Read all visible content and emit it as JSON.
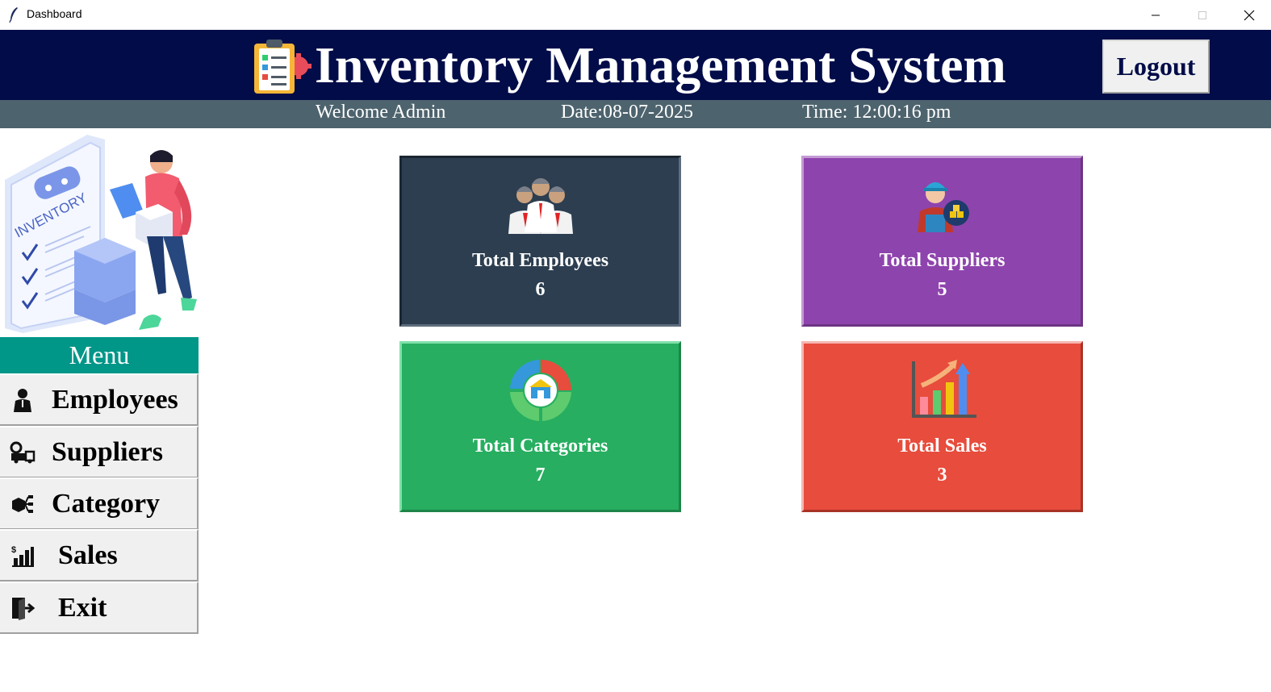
{
  "window": {
    "title": "Dashboard"
  },
  "header": {
    "title": "Inventory Management System",
    "logout_label": "Logout",
    "bg_color": "#010c48"
  },
  "subheader": {
    "welcome": "Welcome Admin",
    "date": "Date:08-07-2025",
    "time": "Time: 12:00:16 pm",
    "bg_color": "#4d636d"
  },
  "sidebar": {
    "illustration_text": "INVENTORY",
    "menu_title": "Menu",
    "items": [
      {
        "label": "Employees",
        "icon": "user-icon"
      },
      {
        "label": "Suppliers",
        "icon": "supplier-icon"
      },
      {
        "label": "Category",
        "icon": "category-icon"
      },
      {
        "label": "Sales",
        "icon": "sales-chart-icon"
      },
      {
        "label": "Exit",
        "icon": "exit-icon"
      }
    ]
  },
  "cards": [
    {
      "label": "Total Employees",
      "value": "6",
      "color": "#2c3e50",
      "icon": "employees-icon"
    },
    {
      "label": "Total Suppliers",
      "value": "5",
      "color": "#8e44ad",
      "icon": "supplier-worker-icon"
    },
    {
      "label": "Total Categories",
      "value": "7",
      "color": "#27ae60",
      "icon": "categories-icon"
    },
    {
      "label": "Total Sales",
      "value": "3",
      "color": "#e74c3c",
      "icon": "sales-growth-icon"
    }
  ]
}
